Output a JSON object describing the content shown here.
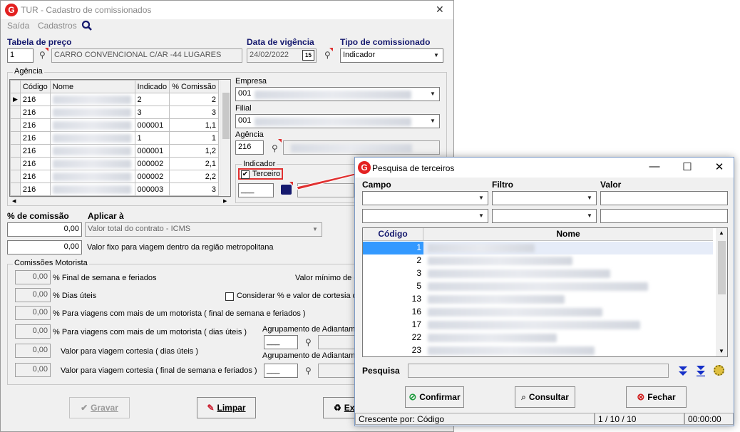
{
  "main": {
    "title": "TUR - Cadastro de comissionados",
    "close_glyph": "✕",
    "logo_letter": "G",
    "menu": {
      "saida": "Saída",
      "cadastros": "Cadastros"
    },
    "tabela_preco": {
      "label": "Tabela de preço",
      "code": "1",
      "name": "CARRO CONVENCIONAL C/AR -44 LUGARES"
    },
    "data_vigencia": {
      "label": "Data de vigência",
      "value": "24/02/2022",
      "cal": "15"
    },
    "tipo_comissionado": {
      "label": "Tipo de comissionado",
      "value": "Indicador"
    },
    "agencia_group": {
      "title": "Agência",
      "columns": [
        "Código",
        "Nome",
        "Indicado",
        "% Comissão"
      ],
      "rows": [
        {
          "codigo": "216",
          "indicado": "2",
          "comissao": "2"
        },
        {
          "codigo": "216",
          "indicado": "3",
          "comissao": "3"
        },
        {
          "codigo": "216",
          "indicado": "000001",
          "comissao": "1,1"
        },
        {
          "codigo": "216",
          "indicado": "1",
          "comissao": "1"
        },
        {
          "codigo": "216",
          "indicado": "000001",
          "comissao": "1,2"
        },
        {
          "codigo": "216",
          "indicado": "000002",
          "comissao": "2,1"
        },
        {
          "codigo": "216",
          "indicado": "000002",
          "comissao": "2,2"
        },
        {
          "codigo": "216",
          "indicado": "000003",
          "comissao": "3"
        }
      ],
      "empresa_label": "Empresa",
      "empresa_value": "001",
      "filial_label": "Filial",
      "filial_value": "001",
      "agencia_label": "Agência",
      "agencia_value": "216",
      "indicador_label": "Indicador",
      "terceiro_label": "Terceiro",
      "indicador_code": "___"
    },
    "pct_comissao": {
      "label": "% de comissão",
      "value": "0,00"
    },
    "aplicar": {
      "label": "Aplicar à",
      "value": "Valor total do contrato - ICMS"
    },
    "valor_fixo": {
      "value": "0,00",
      "label": "Valor fixo para viagem dentro da região metropolitana"
    },
    "motorista": {
      "title": "Comissões Motorista",
      "items": [
        {
          "value": "0,00",
          "label": "% Final de semana e feriados"
        },
        {
          "value": "0,00",
          "label": "% Dias úteis"
        },
        {
          "value": "0,00",
          "label": "% Para viagens com mais de um motorista ( final de semana e feriados )"
        },
        {
          "value": "0,00",
          "label": "% Para viagens com mais de um motorista ( dias úteis )"
        },
        {
          "value": "0,00",
          "label": "Valor para viagem cortesia ( dias úteis )"
        },
        {
          "value": "0,00",
          "label": "Valor para viagem cortesia ( final de semana e feriados )"
        }
      ],
      "valor_minimo_label": "Valor mínimo de c",
      "considerar_label": "Considerar % e valor de cortesia de",
      "agrupamento_label_1": "Agrupamento de Adiantame",
      "agrupamento_label_2": "Agrupamento de Adiantame",
      "agrup_code_1": "___",
      "agrup_code_2": "___"
    },
    "buttons": {
      "gravar": "Gravar",
      "limpar": "Limpar",
      "excluir": "Ex"
    }
  },
  "dialog": {
    "title": "Pesquisa de terceiros",
    "minimize": "—",
    "maximize": "☐",
    "close": "✕",
    "campo_label": "Campo",
    "filtro_label": "Filtro",
    "valor_label": "Valor",
    "grid_columns": [
      "Código",
      "Nome"
    ],
    "grid_codes": [
      "1",
      "2",
      "3",
      "5",
      "13",
      "16",
      "17",
      "22",
      "23"
    ],
    "pesquisa_label": "Pesquisa",
    "buttons": {
      "confirmar": "Confirmar",
      "consultar": "Consultar",
      "fechar": "Fechar"
    },
    "status": {
      "order": "Crescente por: Código",
      "count": "1 / 10 / 10",
      "time": "00:00:00"
    }
  },
  "colors": {
    "accent_blue": "#15196e",
    "highlight": "#e03030",
    "selection": "#3399ff"
  }
}
